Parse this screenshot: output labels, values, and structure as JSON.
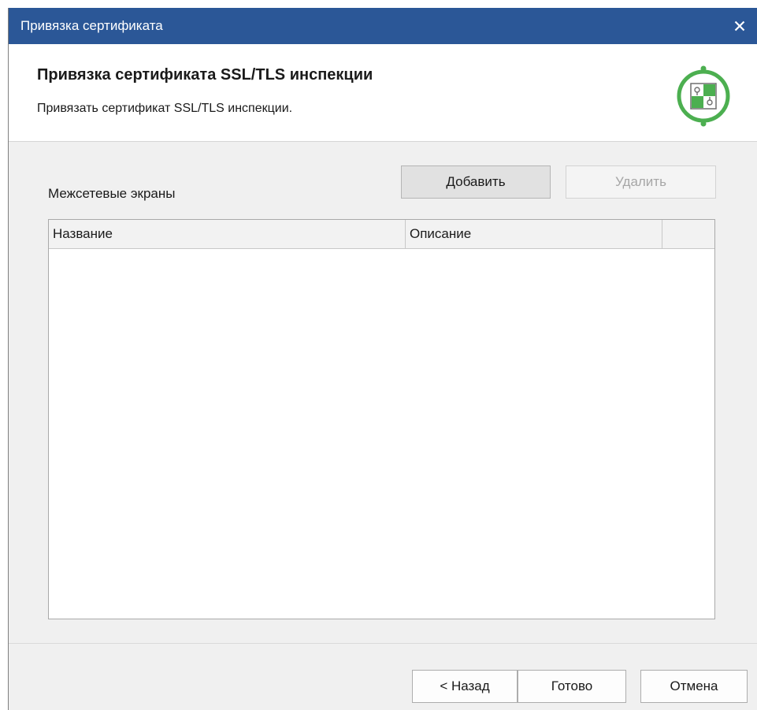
{
  "window": {
    "title": "Привязка сертификата",
    "close_icon": "close-icon"
  },
  "header": {
    "title": "Привязка сертификата SSL/TLS инспекции",
    "subtitle": "Привязать сертификат SSL/TLS инспекции.",
    "logo_icon": "certificate-logo-icon",
    "accent_color": "#4caf50"
  },
  "firewalls": {
    "label": "Межсетевые экраны",
    "add_label": "Добавить",
    "delete_label": "Удалить",
    "columns": [
      "Название",
      "Описание",
      ""
    ],
    "rows": []
  },
  "footer": {
    "back_label": "< Назад",
    "done_label": "Готово",
    "cancel_label": "Отмена"
  },
  "colors": {
    "titlebar": "#2b5797",
    "dialog_bg": "#f0f0f0",
    "disabled_text": "#a6a6a6"
  }
}
